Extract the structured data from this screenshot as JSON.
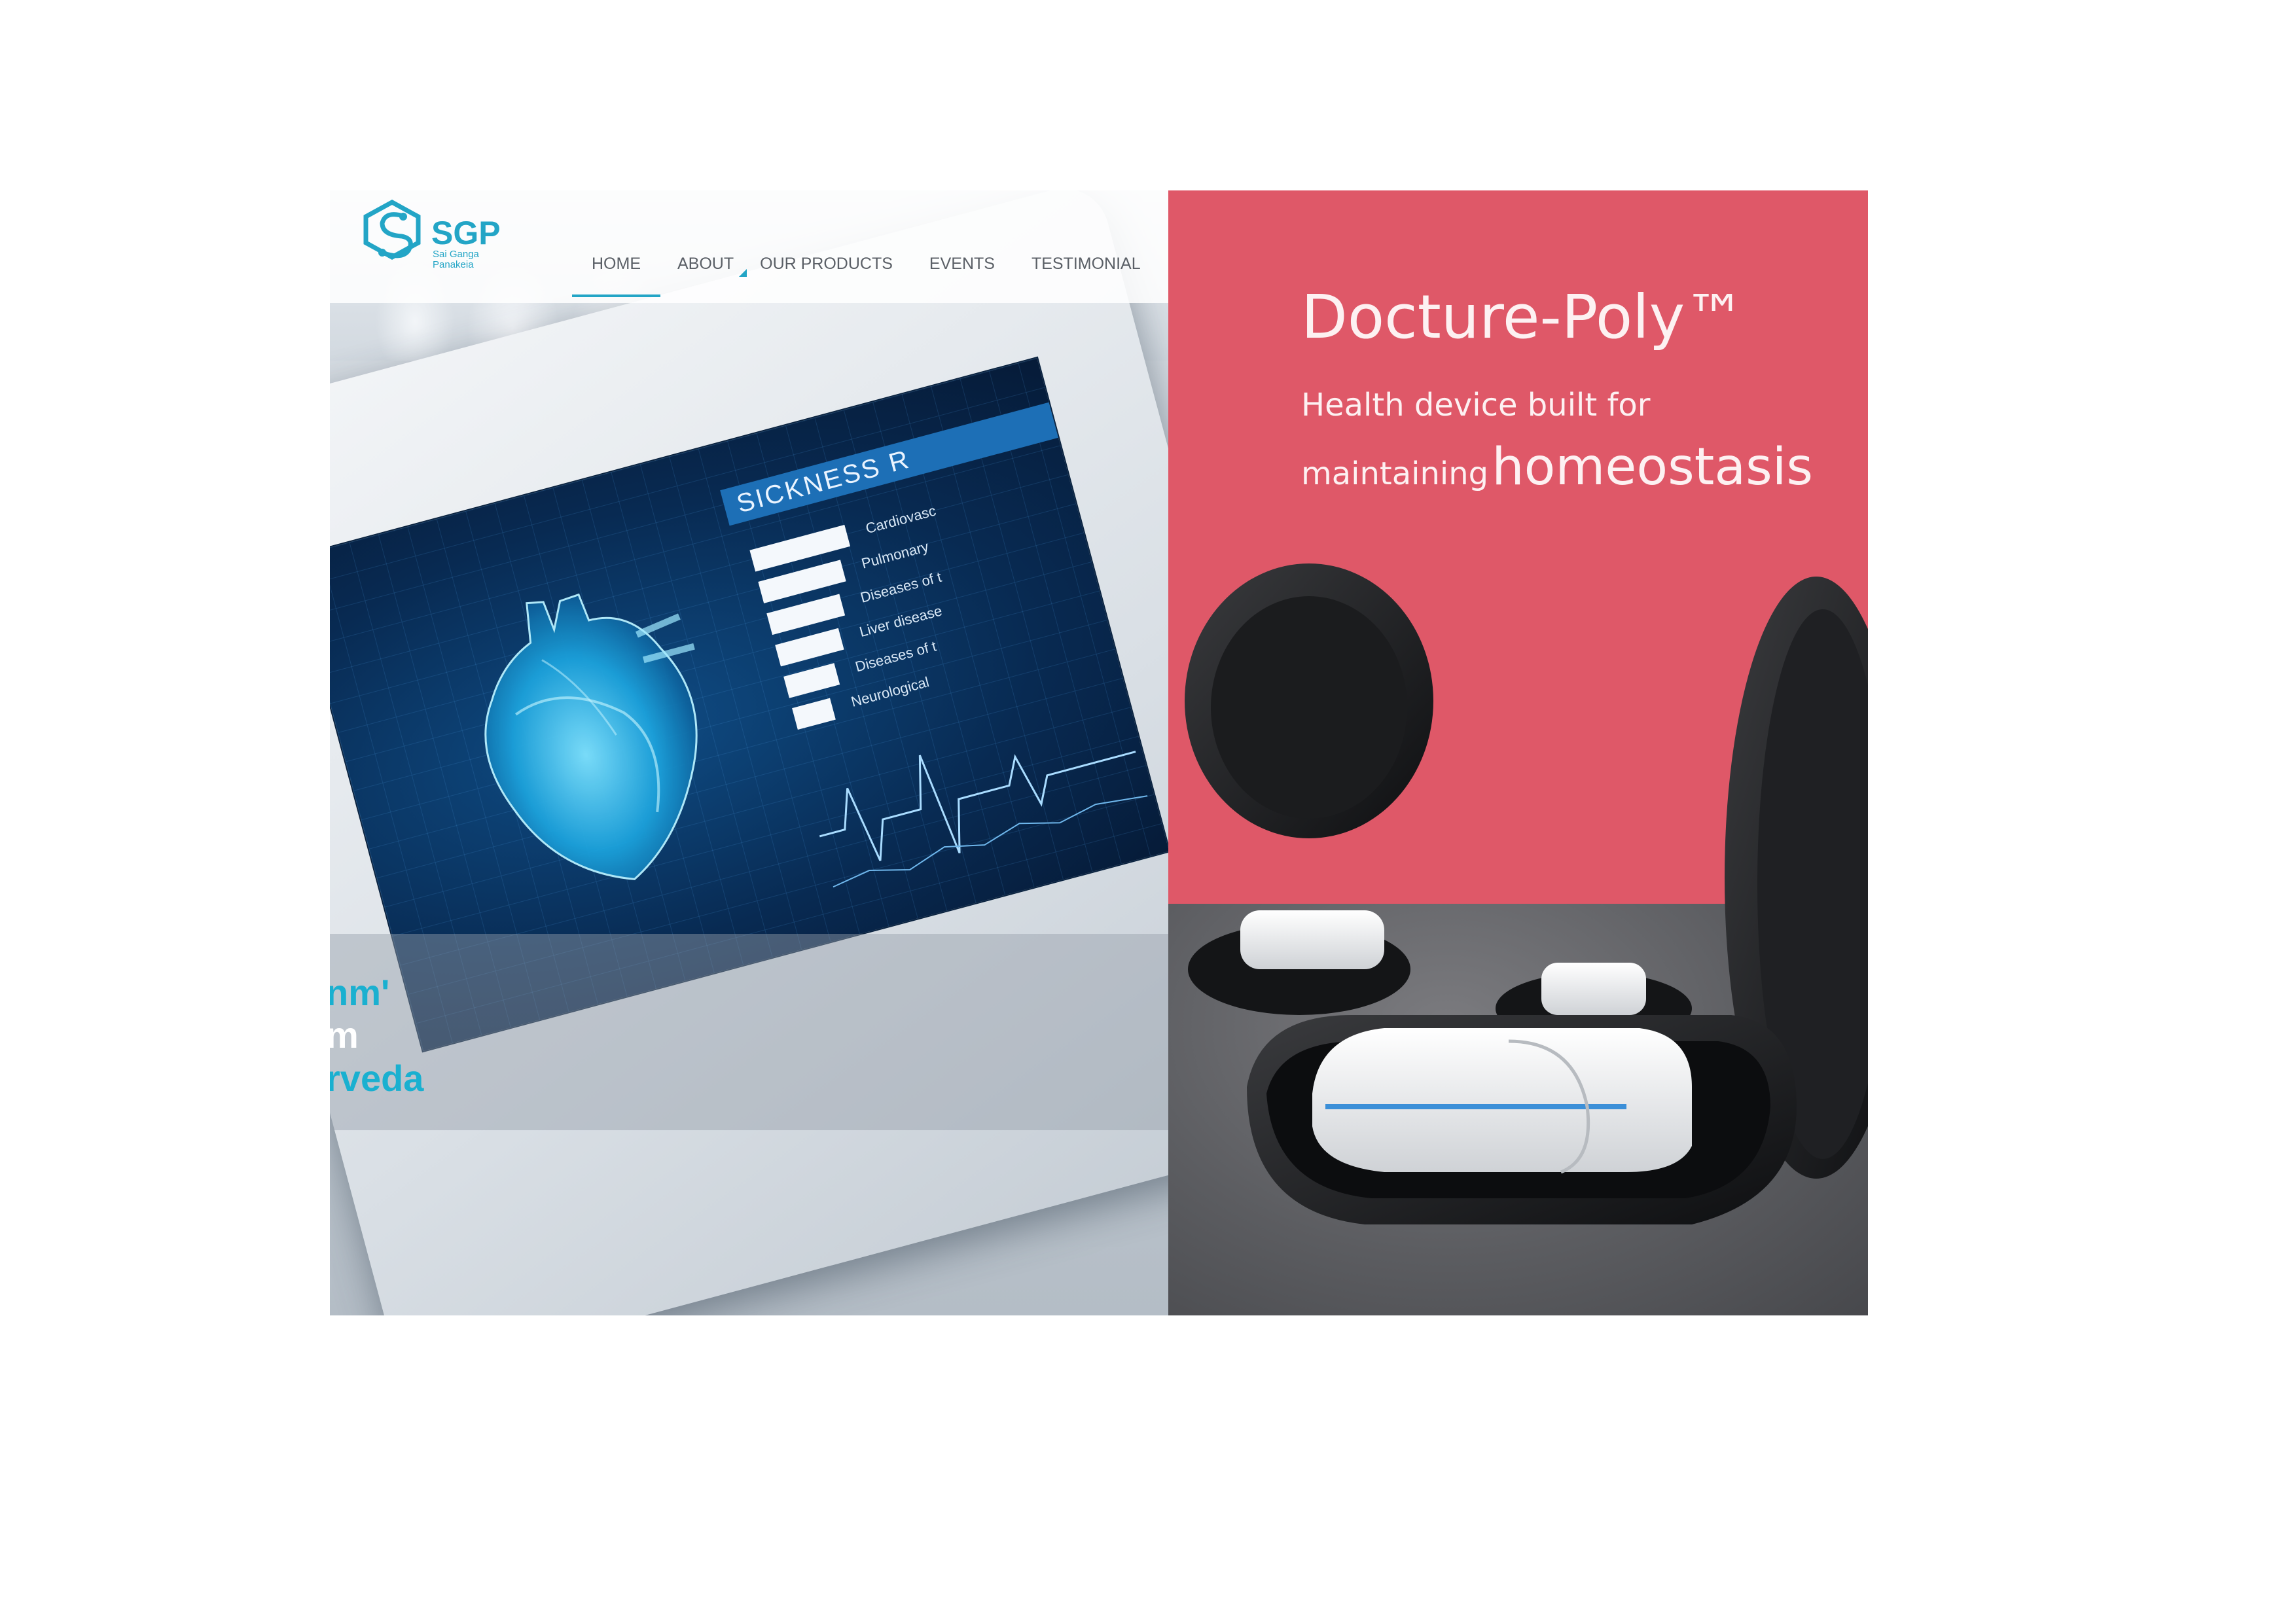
{
  "brand": {
    "logo_text": "SGP",
    "logo_subtitle_line1": "Sai Ganga",
    "logo_subtitle_line2": "Panakeia",
    "accent_color": "#23a5c6"
  },
  "nav": {
    "items": [
      {
        "label": "HOME"
      },
      {
        "label": "ABOUT"
      },
      {
        "label": "OUR PRODUCTS"
      },
      {
        "label": "EVENTS"
      },
      {
        "label": "TESTIMONIAL"
      }
    ]
  },
  "hero": {
    "screen_title": "SICKNESS R",
    "screen_list": [
      "Cardiovasc",
      "Pulmonary",
      "Diseases of t",
      "Liver disease",
      "Diseases of t",
      "Neurological"
    ],
    "caption_lines": [
      "nm'",
      "m",
      "rveda"
    ]
  },
  "product": {
    "title": "Docture-Poly™",
    "subtitle_line1": "Health device built for",
    "subtitle_line2_small": "maintaining",
    "subtitle_line2_big": "homeostasis",
    "background_color": "#df5868"
  }
}
